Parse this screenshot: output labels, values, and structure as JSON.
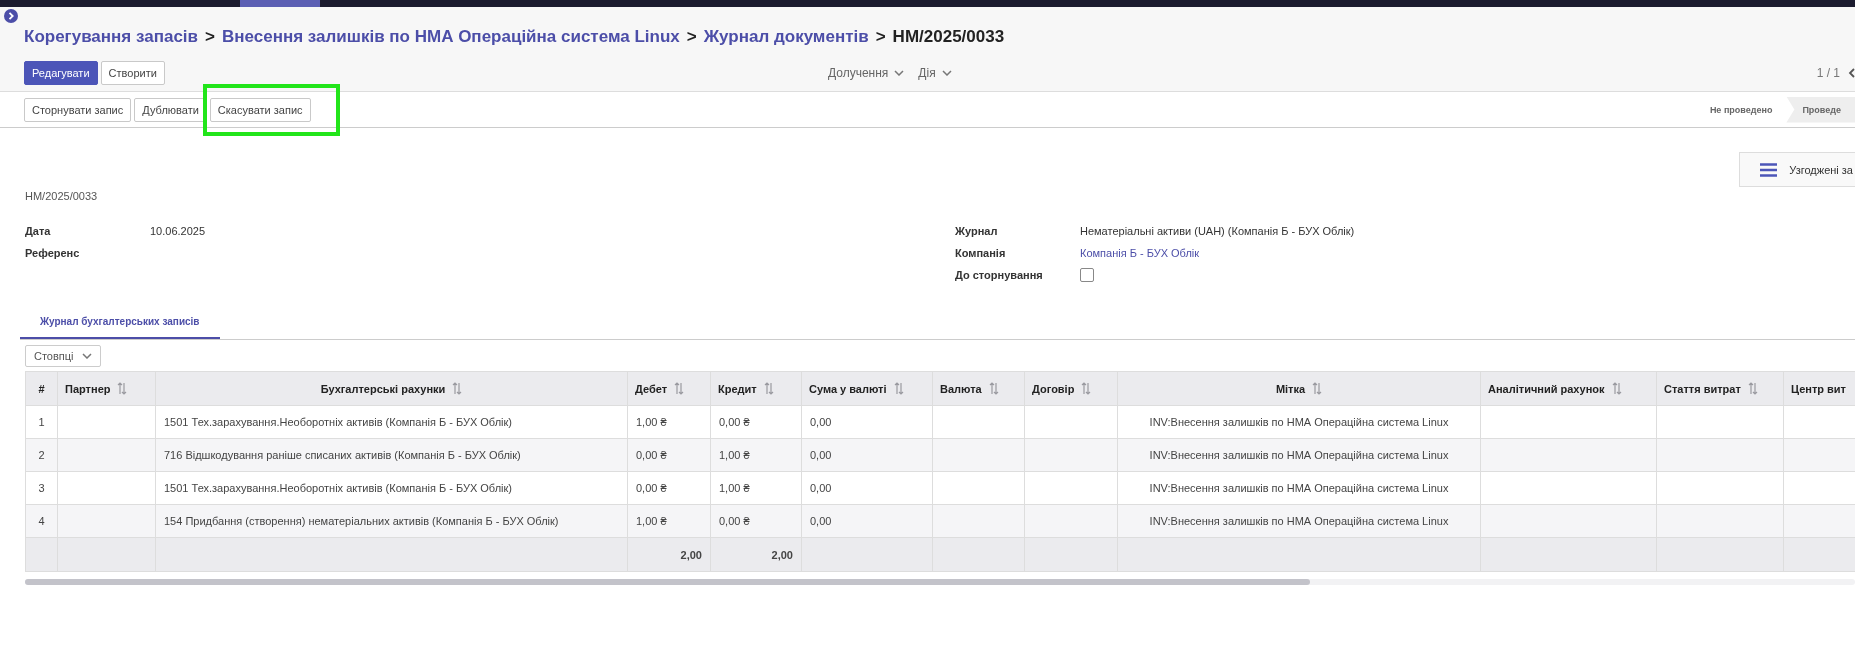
{
  "breadcrumbs": [
    {
      "label": "Корегування запасів",
      "current": false
    },
    {
      "label": "Внесення залишків по НМА Операційна система Linux",
      "current": false
    },
    {
      "label": "Журнал документів",
      "current": false
    },
    {
      "label": "НМ/2025/0033",
      "current": true
    }
  ],
  "breadcrumb_separator": ">",
  "buttons": [
    {
      "label": "Редагувати",
      "primary": true
    },
    {
      "label": "Створити",
      "primary": false
    }
  ],
  "menus": [
    "Долучення",
    "Дія"
  ],
  "pager": {
    "text": "1 / 1"
  },
  "action_buttons": [
    {
      "label": "Сторнувати запис",
      "highlighted": false
    },
    {
      "label": "Дублювати",
      "highlighted": false
    },
    {
      "label": "Скасувати запис",
      "highlighted": true
    }
  ],
  "statuses": [
    {
      "label": "Не проведено",
      "selected": false
    },
    {
      "label": "Проведе",
      "selected": true
    }
  ],
  "smart_button": {
    "label": "Узгоджені за"
  },
  "record_name": "НМ/2025/0033",
  "left_fields": [
    {
      "label": "Дата",
      "value": "10.06.2025"
    },
    {
      "label": "Референс"
    }
  ],
  "right_fields": [
    {
      "label": "Журнал",
      "value": "Нематеріальні активи (UAH) (Компанія Б - БУХ Облік)",
      "kind": "text"
    },
    {
      "label": "Компанія",
      "value": "Компанія Б - БУХ Облік",
      "kind": "link"
    },
    {
      "label": "До сторнування",
      "kind": "checkbox",
      "checked": false
    }
  ],
  "tabs": [
    {
      "label": "Журнал бухгалтерських записів",
      "selected": true
    }
  ],
  "columns_button": "Стовпці",
  "table": {
    "columns": [
      {
        "label": "#",
        "sortable": false
      },
      {
        "label": "Партнер",
        "sortable": true
      },
      {
        "label": "Бухгалтерські рахунки",
        "sortable": true
      },
      {
        "label": "Дебет",
        "sortable": true
      },
      {
        "label": "Кредит",
        "sortable": true
      },
      {
        "label": "Сума у валюті",
        "sortable": true
      },
      {
        "label": "Валюта",
        "sortable": true
      },
      {
        "label": "Договір",
        "sortable": true
      },
      {
        "label": "Мітка",
        "sortable": true
      },
      {
        "label": "Аналітичний рахунок",
        "sortable": true
      },
      {
        "label": "Стаття витрат",
        "sortable": true
      },
      {
        "label": "Центр вит",
        "sortable": false
      }
    ],
    "rows": [
      {
        "cells": [
          "1",
          "",
          "1501 Тех.зарахування.Необоротніх активів (Компанія Б - БУХ Облік)",
          "1,00 ₴",
          "0,00 ₴",
          "0,00",
          "",
          "",
          "INV:Внесення залишків по НМА Операційна система Linux",
          "",
          "",
          ""
        ]
      },
      {
        "cells": [
          "2",
          "",
          "716 Відшкодування раніше списаних активів (Компанія Б - БУХ Облік)",
          "0,00 ₴",
          "1,00 ₴",
          "0,00",
          "",
          "",
          "INV:Внесення залишків по НМА Операційна система Linux",
          "",
          "",
          ""
        ]
      },
      {
        "cells": [
          "3",
          "",
          "1501 Тех.зарахування.Необоротніх активів (Компанія Б - БУХ Облік)",
          "0,00 ₴",
          "1,00 ₴",
          "0,00",
          "",
          "",
          "INV:Внесення залишків по НМА Операційна система Linux",
          "",
          "",
          ""
        ]
      },
      {
        "cells": [
          "4",
          "",
          "154 Придбання (створення) нематеріальних активів (Компанія Б - БУХ Облік)",
          "1,00 ₴",
          "0,00 ₴",
          "0,00",
          "",
          "",
          "INV:Внесення залишків по НМА Операційна система Linux",
          "",
          "",
          ""
        ]
      }
    ],
    "totals": {
      "debit": "2,00",
      "credit": "2,00"
    }
  }
}
